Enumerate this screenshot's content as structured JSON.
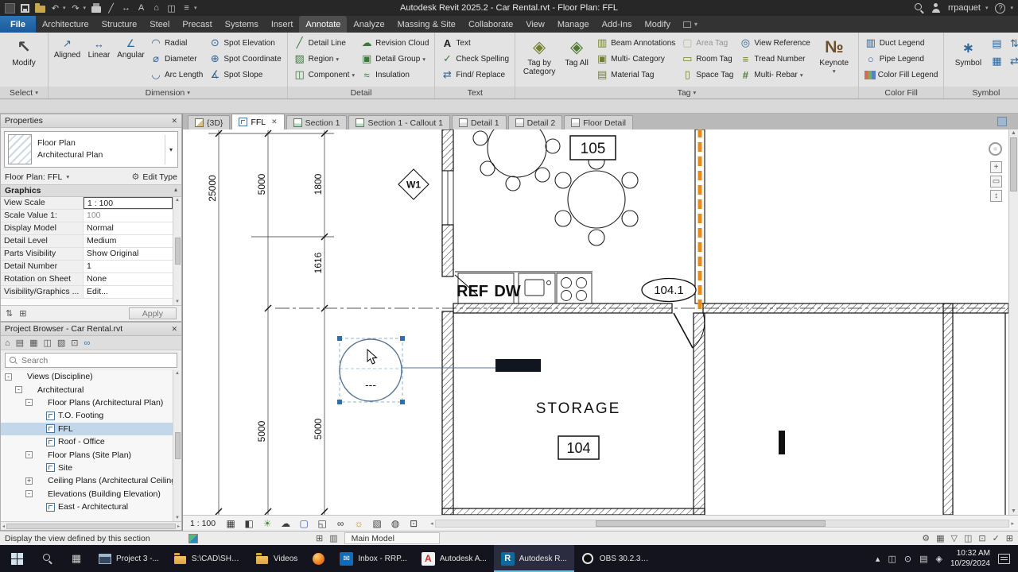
{
  "titlebar": {
    "title": "Autodesk Revit 2025.2 - Car Rental.rvt - Floor Plan: FFL",
    "user": "rrpaquet"
  },
  "ribbon_tabs": {
    "file": "File",
    "tabs": [
      {
        "label": "Architecture"
      },
      {
        "label": "Structure"
      },
      {
        "label": "Steel"
      },
      {
        "label": "Precast"
      },
      {
        "label": "Systems"
      },
      {
        "label": "Insert"
      },
      {
        "label": "Annotate",
        "active": true
      },
      {
        "label": "Analyze"
      },
      {
        "label": "Massing & Site"
      },
      {
        "label": "Collaborate"
      },
      {
        "label": "View"
      },
      {
        "label": "Manage"
      },
      {
        "label": "Add-Ins"
      },
      {
        "label": "Modify"
      }
    ]
  },
  "ribbon": {
    "modify_label": "Modify",
    "select_label": "Select",
    "dimension": {
      "panel": "Dimension",
      "aligned": "Aligned",
      "linear": "Linear",
      "angular": "Angular",
      "radial": "Radial",
      "diameter": "Diameter",
      "arc_length": "Arc Length",
      "spot_elevation": "Spot Elevation",
      "spot_coordinate": "Spot Coordinate",
      "spot_slope": "Spot Slope"
    },
    "detail": {
      "panel": "Detail",
      "detail_line": "Detail Line",
      "region": "Region",
      "component": "Component",
      "revision_cloud": "Revision Cloud",
      "detail_group": "Detail Group",
      "insulation": "Insulation"
    },
    "text": {
      "panel": "Text",
      "text": "Text",
      "check_spelling": "Check Spelling",
      "find_replace": "Find/ Replace"
    },
    "tag": {
      "panel": "Tag",
      "tag_by_category": "Tag by Category",
      "tag_all": "Tag All",
      "beam_annotations": "Beam Annotations",
      "multi_category": "Multi- Category",
      "material_tag": "Material Tag",
      "area_tag": "Area Tag",
      "room_tag": "Room Tag",
      "space_tag": "Space Tag",
      "view_reference": "View Reference",
      "tread_number": "Tread Number",
      "multi_rebar": "Multi- Rebar",
      "keynote": "Keynote"
    },
    "color_fill": {
      "panel": "Color Fill",
      "duct_legend": "Duct Legend",
      "pipe_legend": "Pipe Legend",
      "color_fill_legend": "Color Fill Legend"
    },
    "symbol": {
      "panel": "Symbol",
      "symbol": "Symbol"
    }
  },
  "properties": {
    "title": "Properties",
    "type_name": "Floor Plan",
    "type_family": "Architectural Plan",
    "instance": "Floor Plan: FFL",
    "edit_type": "Edit Type",
    "section": "Graphics",
    "rows": [
      {
        "label": "View Scale",
        "value": "1 : 100",
        "field": true
      },
      {
        "label": "Scale Value    1:",
        "value": "100",
        "muted": true
      },
      {
        "label": "Display Model",
        "value": "Normal"
      },
      {
        "label": "Detail Level",
        "value": "Medium"
      },
      {
        "label": "Parts Visibility",
        "value": "Show Original"
      },
      {
        "label": "Detail Number",
        "value": "1"
      },
      {
        "label": "Rotation on Sheet",
        "value": "None"
      },
      {
        "label": "Visibility/Graphics ...",
        "value": "Edit..."
      }
    ],
    "apply": "Apply"
  },
  "browser": {
    "title": "Project Browser - Car Rental.rvt",
    "search_placeholder": "Search",
    "tree": [
      {
        "label": "Views (Discipline)",
        "depth": 0,
        "expander": "-"
      },
      {
        "label": "Architectural",
        "depth": 1,
        "expander": "-"
      },
      {
        "label": "Floor Plans (Architectural Plan)",
        "depth": 2,
        "expander": "-"
      },
      {
        "label": "T.O. Footing",
        "depth": 3,
        "icon": "plan"
      },
      {
        "label": "FFL",
        "depth": 3,
        "icon": "plan",
        "selected": true
      },
      {
        "label": "Roof - Office",
        "depth": 3,
        "icon": "plan"
      },
      {
        "label": "Floor Plans (Site Plan)",
        "depth": 2,
        "expander": "-"
      },
      {
        "label": "Site",
        "depth": 3,
        "icon": "plan"
      },
      {
        "label": "Ceiling Plans (Architectural Ceiling Pla",
        "depth": 2,
        "expander": "+"
      },
      {
        "label": "Elevations (Building Elevation)",
        "depth": 2,
        "expander": "-"
      },
      {
        "label": "East - Architectural",
        "depth": 3,
        "icon": "plan"
      }
    ]
  },
  "view_tabs": [
    {
      "label": "{3D}",
      "icon": "3d"
    },
    {
      "label": "FFL",
      "icon": "plan",
      "active": true,
      "closable": true
    },
    {
      "label": "Section 1",
      "icon": "section"
    },
    {
      "label": "Section 1 - Callout 1",
      "icon": "section"
    },
    {
      "label": "Detail 1",
      "icon": "detail"
    },
    {
      "label": "Detail 2",
      "icon": "detail"
    },
    {
      "label": "Floor Detail",
      "icon": "detail"
    }
  ],
  "drawing": {
    "dim_25000": "25000",
    "dim_5000_top": "5000",
    "dim_5000_bottom": "5000",
    "dim_1800": "1800",
    "dim_1616": "1616",
    "dim_5000_right": "5000",
    "window_w1": "W1",
    "room_105": "105",
    "door_104_1": "104.1",
    "ref_label": "REF",
    "dw_label": "DW",
    "storage_label": "STORAGE",
    "room_104": "104",
    "section_head": "---"
  },
  "view_controls": {
    "scale": "1 : 100"
  },
  "statusbar": {
    "hint": "Display the view defined by this section",
    "main_model": "Main Model"
  },
  "taskbar": {
    "items": [
      {
        "label": "Project 3 -...",
        "icon": "window"
      },
      {
        "label": "S:\\CAD\\SHA...",
        "icon": "folder"
      },
      {
        "label": "Videos",
        "icon": "folder"
      },
      {
        "label": "",
        "icon": "firefox"
      },
      {
        "label": "Inbox - RRP...",
        "icon": "mail"
      },
      {
        "label": "Autodesk A...",
        "icon": "acad"
      },
      {
        "label": "Autodesk R...",
        "icon": "revit",
        "active": true
      },
      {
        "label": "OBS 30.2.3 -...",
        "icon": "obs"
      }
    ],
    "time": "10:32 AM",
    "date": "10/29/2024"
  }
}
